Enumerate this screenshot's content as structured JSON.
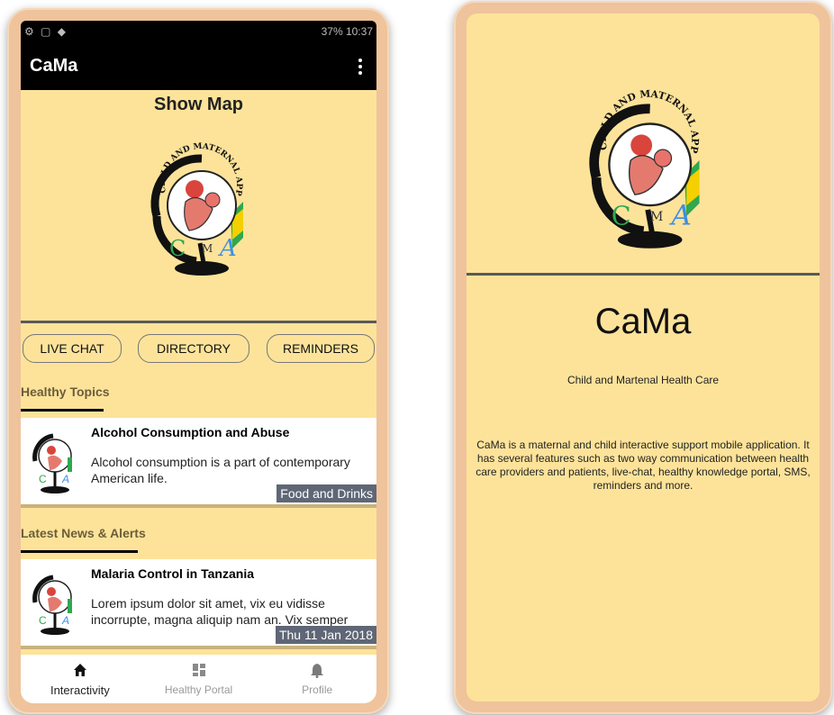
{
  "left_screen": {
    "status_bar": {
      "left_icons": "⚙ ▢ ◆",
      "right_text": "37% 10:37"
    },
    "app_bar": {
      "title": "CaMa"
    },
    "show_map_label": "Show Map",
    "logo": {
      "arc_text": "CHILD AND MATERNAL APP",
      "letters": [
        "C",
        "M",
        "A"
      ]
    },
    "buttons": {
      "live_chat": "LIVE CHAT",
      "directory": "DIRECTORY",
      "reminders": "REMINDERS"
    },
    "sections": {
      "healthy_topics": {
        "title": "Healthy Topics",
        "card": {
          "title": "Alcohol Consumption and Abuse",
          "body": "Alcohol consumption is a part of contemporary American life.",
          "tag": "Food and Drinks"
        }
      },
      "news": {
        "title": "Latest News & Alerts",
        "card": {
          "title": "Malaria Control in Tanzania",
          "body": "Lorem ipsum dolor sit amet, vix eu vidisse incorrupte, magna aliquip nam an. Vix semper",
          "tag": "Thu 11 Jan 2018"
        }
      }
    },
    "bottom_nav": [
      {
        "label": "Interactivity",
        "icon": "home-icon",
        "active": true
      },
      {
        "label": "Healthy Portal",
        "icon": "grid-icon",
        "active": false
      },
      {
        "label": "Profile",
        "icon": "bell-icon",
        "active": false
      }
    ]
  },
  "right_screen": {
    "logo": {
      "arc_text": "CHILD AND MATERNAL APP",
      "letters": [
        "C",
        "M",
        "A"
      ]
    },
    "title": "CaMa",
    "subtitle": "Child and Martenal Health Care",
    "description": "CaMa is a maternal and child interactive support mobile application. It has several features such as two way communication between health care providers and patients, live-chat, healthy knowledge portal, SMS, reminders and more."
  },
  "colors": {
    "background": "#fde39a",
    "app_bar": "#000000",
    "frame": "#efc39b",
    "tag": "#5f6776",
    "logo_blue": "#3c8ee6",
    "logo_green": "#2fa84f"
  }
}
